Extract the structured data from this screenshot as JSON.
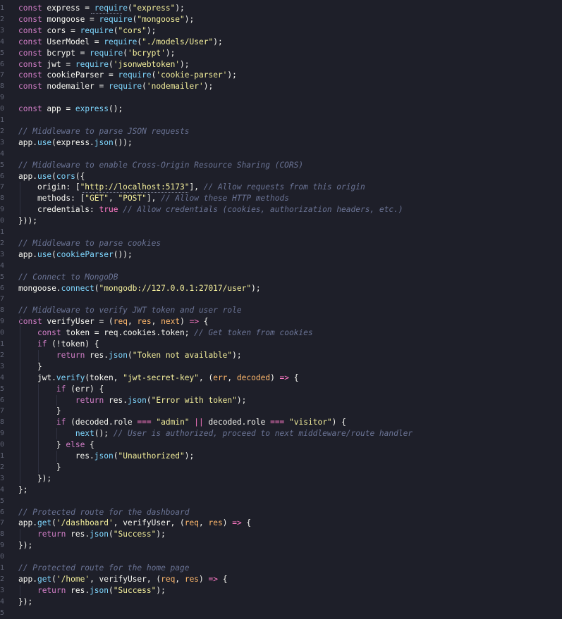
{
  "editor": {
    "language": "javascript",
    "gutter_numbers": [
      "1",
      "2",
      "3",
      "4",
      "5",
      "6",
      "7",
      "8",
      "9",
      "0",
      "1",
      "2",
      "3",
      "4",
      "5",
      "6",
      "7",
      "8",
      "9",
      "0",
      "1",
      "2",
      "3",
      "4",
      "5",
      "6",
      "7",
      "8",
      "9",
      "0",
      "1",
      "2",
      "3",
      "4",
      "5",
      "6",
      "7",
      "8",
      "9",
      "0",
      "1",
      "2",
      "3",
      "4",
      "5",
      "6",
      "7",
      "8",
      "9",
      "0",
      "1",
      "2",
      "3",
      "4",
      "5",
      "6"
    ],
    "colors": {
      "background": "#1e1f29",
      "keyword": "#d37fc8",
      "variable": "#f8f8f2",
      "function": "#7fd7ff",
      "string": "#f3ee9b",
      "comment": "#6a7394",
      "parameter": "#ffb86c",
      "property": "#7fd7ff",
      "operator": "#ff7ac6",
      "boolean": "#ff7ac6",
      "line_number": "#5f6374"
    },
    "lines": [
      [
        [
          "const",
          "kw"
        ],
        [
          " express = ",
          "var"
        ],
        [
          "require",
          "fn"
        ],
        [
          "(",
          "var"
        ],
        [
          "\"express\"",
          "str"
        ],
        [
          ");",
          "var"
        ]
      ],
      [
        [
          "const",
          "kw"
        ],
        [
          " mongoose = ",
          "var"
        ],
        [
          "require",
          "fn"
        ],
        [
          "(",
          "var"
        ],
        [
          "\"mongoose\"",
          "str"
        ],
        [
          ");",
          "var"
        ]
      ],
      [
        [
          "const",
          "kw"
        ],
        [
          " cors = ",
          "var"
        ],
        [
          "require",
          "fn"
        ],
        [
          "(",
          "var"
        ],
        [
          "\"cors\"",
          "str"
        ],
        [
          ");",
          "var"
        ]
      ],
      [
        [
          "const",
          "kw"
        ],
        [
          " UserModel = ",
          "var"
        ],
        [
          "require",
          "fn"
        ],
        [
          "(",
          "var"
        ],
        [
          "\"./models/User\"",
          "str"
        ],
        [
          ");",
          "var"
        ]
      ],
      [
        [
          "const",
          "kw"
        ],
        [
          " bcrypt = ",
          "var"
        ],
        [
          "require",
          "fn"
        ],
        [
          "(",
          "var"
        ],
        [
          "'bcrypt'",
          "str"
        ],
        [
          ");",
          "var"
        ]
      ],
      [
        [
          "const",
          "kw"
        ],
        [
          " jwt = ",
          "var"
        ],
        [
          "require",
          "fn"
        ],
        [
          "(",
          "var"
        ],
        [
          "'jsonwebtoken'",
          "str"
        ],
        [
          ");",
          "var"
        ]
      ],
      [
        [
          "const",
          "kw"
        ],
        [
          " cookieParser = ",
          "var"
        ],
        [
          "require",
          "fn"
        ],
        [
          "(",
          "var"
        ],
        [
          "'cookie-parser'",
          "str"
        ],
        [
          ");",
          "var"
        ]
      ],
      [
        [
          "const",
          "kw"
        ],
        [
          " nodemailer = ",
          "var"
        ],
        [
          "require",
          "fn"
        ],
        [
          "(",
          "var"
        ],
        [
          "'nodemailer'",
          "str"
        ],
        [
          ");",
          "var"
        ]
      ],
      [],
      [
        [
          "const",
          "kw"
        ],
        [
          " app = ",
          "var"
        ],
        [
          "express",
          "fn"
        ],
        [
          "();",
          "var"
        ]
      ],
      [],
      [
        [
          "// Middleware to parse JSON requests",
          "cm"
        ]
      ],
      [
        [
          "app.",
          "var"
        ],
        [
          "use",
          "fn"
        ],
        [
          "(express.",
          "var"
        ],
        [
          "json",
          "fn"
        ],
        [
          "());",
          "var"
        ]
      ],
      [],
      [
        [
          "// Middleware to enable Cross-Origin Resource Sharing (CORS)",
          "cm"
        ]
      ],
      [
        [
          "app.",
          "var"
        ],
        [
          "use",
          "fn"
        ],
        [
          "(",
          "var"
        ],
        [
          "cors",
          "fn"
        ],
        [
          "({",
          "var"
        ]
      ],
      [
        [
          "    origin: [",
          "var"
        ],
        [
          "\"http://localhost:5173\"",
          "str"
        ],
        [
          "], ",
          "var"
        ],
        [
          "// Allow requests from this origin",
          "cm"
        ]
      ],
      [
        [
          "    methods: [",
          "var"
        ],
        [
          "\"GET\"",
          "str"
        ],
        [
          ", ",
          "var"
        ],
        [
          "\"POST\"",
          "str"
        ],
        [
          "], ",
          "var"
        ],
        [
          "// Allow these HTTP methods",
          "cm"
        ]
      ],
      [
        [
          "    credentials: ",
          "var"
        ],
        [
          "true",
          "bool"
        ],
        [
          " ",
          "var"
        ],
        [
          "// Allow credentials (cookies, authorization headers, etc.)",
          "cm"
        ]
      ],
      [
        [
          "}));",
          "var"
        ]
      ],
      [],
      [
        [
          "// Middleware to parse cookies",
          "cm"
        ]
      ],
      [
        [
          "app.",
          "var"
        ],
        [
          "use",
          "fn"
        ],
        [
          "(",
          "var"
        ],
        [
          "cookieParser",
          "fn"
        ],
        [
          "());",
          "var"
        ]
      ],
      [],
      [
        [
          "// Connect to MongoDB",
          "cm"
        ]
      ],
      [
        [
          "mongoose.",
          "var"
        ],
        [
          "connect",
          "fn"
        ],
        [
          "(",
          "var"
        ],
        [
          "\"mongodb://127.0.0.1:27017/user\"",
          "str"
        ],
        [
          ");",
          "var"
        ]
      ],
      [],
      [
        [
          "// Middleware to verify JWT token and user role",
          "cm"
        ]
      ],
      [
        [
          "const",
          "kw"
        ],
        [
          " verifyUser = (",
          "var"
        ],
        [
          "req",
          "param"
        ],
        [
          ", ",
          "var"
        ],
        [
          "res",
          "param"
        ],
        [
          ", ",
          "var"
        ],
        [
          "next",
          "param"
        ],
        [
          ") ",
          "var"
        ],
        [
          "=>",
          "op"
        ],
        [
          " {",
          "var"
        ]
      ],
      [
        [
          "    ",
          "var"
        ],
        [
          "const",
          "kw"
        ],
        [
          " token = req.cookies.token; ",
          "var"
        ],
        [
          "// Get token from cookies",
          "cm"
        ]
      ],
      [
        [
          "    ",
          "var"
        ],
        [
          "if",
          "kw"
        ],
        [
          " (!token) {",
          "var"
        ]
      ],
      [
        [
          "        ",
          "var"
        ],
        [
          "return",
          "kw"
        ],
        [
          " res.",
          "var"
        ],
        [
          "json",
          "fn"
        ],
        [
          "(",
          "var"
        ],
        [
          "\"Token not available\"",
          "str"
        ],
        [
          ");",
          "var"
        ]
      ],
      [
        [
          "    }",
          "var"
        ]
      ],
      [
        [
          "    jwt.",
          "var"
        ],
        [
          "verify",
          "fn"
        ],
        [
          "(token, ",
          "var"
        ],
        [
          "\"jwt-secret-key\"",
          "str"
        ],
        [
          ", (",
          "var"
        ],
        [
          "err",
          "param"
        ],
        [
          ", ",
          "var"
        ],
        [
          "decoded",
          "param"
        ],
        [
          ") ",
          "var"
        ],
        [
          "=>",
          "op"
        ],
        [
          " {",
          "var"
        ]
      ],
      [
        [
          "        ",
          "var"
        ],
        [
          "if",
          "kw"
        ],
        [
          " (err) {",
          "var"
        ]
      ],
      [
        [
          "            ",
          "var"
        ],
        [
          "return",
          "kw"
        ],
        [
          " res.",
          "var"
        ],
        [
          "json",
          "fn"
        ],
        [
          "(",
          "var"
        ],
        [
          "\"Error with token\"",
          "str"
        ],
        [
          ");",
          "var"
        ]
      ],
      [
        [
          "        }",
          "var"
        ]
      ],
      [
        [
          "        ",
          "var"
        ],
        [
          "if",
          "kw"
        ],
        [
          " (decoded.role ",
          "var"
        ],
        [
          "===",
          "op"
        ],
        [
          " ",
          "var"
        ],
        [
          "\"admin\"",
          "str"
        ],
        [
          " ",
          "var"
        ],
        [
          "||",
          "op"
        ],
        [
          " decoded.role ",
          "var"
        ],
        [
          "===",
          "op"
        ],
        [
          " ",
          "var"
        ],
        [
          "\"visitor\"",
          "str"
        ],
        [
          ") {",
          "var"
        ]
      ],
      [
        [
          "            ",
          "var"
        ],
        [
          "next",
          "fn"
        ],
        [
          "(); ",
          "var"
        ],
        [
          "// User is authorized, proceed to next middleware/route handler",
          "cm"
        ]
      ],
      [
        [
          "        } ",
          "var"
        ],
        [
          "else",
          "kw"
        ],
        [
          " {",
          "var"
        ]
      ],
      [
        [
          "            res.",
          "var"
        ],
        [
          "json",
          "fn"
        ],
        [
          "(",
          "var"
        ],
        [
          "\"Unauthorized\"",
          "str"
        ],
        [
          ");",
          "var"
        ]
      ],
      [
        [
          "        }",
          "var"
        ]
      ],
      [
        [
          "    });",
          "var"
        ]
      ],
      [
        [
          "};",
          "var"
        ]
      ],
      [],
      [
        [
          "// Protected route for the dashboard",
          "cm"
        ]
      ],
      [
        [
          "app.",
          "var"
        ],
        [
          "get",
          "fn"
        ],
        [
          "(",
          "var"
        ],
        [
          "'/dashboard'",
          "str"
        ],
        [
          ", verifyUser, (",
          "var"
        ],
        [
          "req",
          "param"
        ],
        [
          ", ",
          "var"
        ],
        [
          "res",
          "param"
        ],
        [
          ") ",
          "var"
        ],
        [
          "=>",
          "op"
        ],
        [
          " {",
          "var"
        ]
      ],
      [
        [
          "    ",
          "var"
        ],
        [
          "return",
          "kw"
        ],
        [
          " res.",
          "var"
        ],
        [
          "json",
          "fn"
        ],
        [
          "(",
          "var"
        ],
        [
          "\"Success\"",
          "str"
        ],
        [
          ");",
          "var"
        ]
      ],
      [
        [
          "});",
          "var"
        ]
      ],
      [],
      [
        [
          "// Protected route for the home page",
          "cm"
        ]
      ],
      [
        [
          "app.",
          "var"
        ],
        [
          "get",
          "fn"
        ],
        [
          "(",
          "var"
        ],
        [
          "'/home'",
          "str"
        ],
        [
          ", verifyUser, (",
          "var"
        ],
        [
          "req",
          "param"
        ],
        [
          ", ",
          "var"
        ],
        [
          "res",
          "param"
        ],
        [
          ") ",
          "var"
        ],
        [
          "=>",
          "op"
        ],
        [
          " {",
          "var"
        ]
      ],
      [
        [
          "    ",
          "var"
        ],
        [
          "return",
          "kw"
        ],
        [
          " res.",
          "var"
        ],
        [
          "json",
          "fn"
        ],
        [
          "(",
          "var"
        ],
        [
          "\"Success\"",
          "str"
        ],
        [
          ");",
          "var"
        ]
      ],
      [
        [
          "});",
          "var"
        ]
      ],
      [],
      []
    ]
  }
}
